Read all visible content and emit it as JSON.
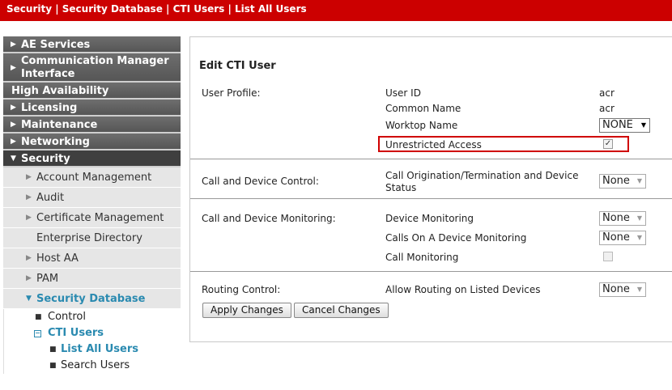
{
  "breadcrumb": "Security | Security Database | CTI Users | List All Users",
  "sidebar": {
    "main_top": [
      {
        "label": "AE Services",
        "arrow": "▶"
      },
      {
        "label": "Communication Manager Interface",
        "arrow": "▶"
      },
      {
        "label": "High Availability",
        "arrow": ""
      },
      {
        "label": "Licensing",
        "arrow": "▶"
      },
      {
        "label": "Maintenance",
        "arrow": "▶"
      },
      {
        "label": "Networking",
        "arrow": "▶"
      },
      {
        "label": "Security",
        "arrow": "▼"
      }
    ],
    "security_items": [
      {
        "label": "Account Management",
        "arrow": "▶"
      },
      {
        "label": "Audit",
        "arrow": "▶"
      },
      {
        "label": "Certificate Management",
        "arrow": "▶"
      },
      {
        "label": "Enterprise Directory",
        "arrow": ""
      },
      {
        "label": "Host AA",
        "arrow": "▶"
      },
      {
        "label": "PAM",
        "arrow": "▶"
      },
      {
        "label": "Security Database",
        "arrow": "▼"
      }
    ],
    "db_items": {
      "control": "Control",
      "cti_users": "CTI Users",
      "list_all": "List All Users",
      "search": "Search Users"
    }
  },
  "form": {
    "title": "Edit CTI User",
    "user_profile_label": "User Profile:",
    "user_id_label": "User ID",
    "user_id_value": "acr",
    "common_name_label": "Common Name",
    "common_name_value": "acr",
    "worktop_label": "Worktop Name",
    "worktop_value": "NONE",
    "unrestricted_label": "Unrestricted Access",
    "unrestricted_checked": true,
    "call_device_control_label": "Call and Device Control:",
    "call_origination_label": "Call Origination/Termination and Device Status",
    "call_origination_value": "None",
    "call_device_monitoring_label": "Call and Device Monitoring:",
    "device_monitoring_label": "Device Monitoring",
    "device_monitoring_value": "None",
    "calls_on_device_label": "Calls On A Device Monitoring",
    "calls_on_device_value": "None",
    "call_monitoring_label": "Call Monitoring",
    "call_monitoring_checked": false,
    "routing_control_label": "Routing Control:",
    "allow_routing_label": "Allow Routing on Listed Devices",
    "allow_routing_value": "None",
    "apply_label": "Apply Changes",
    "cancel_label": "Cancel Changes"
  },
  "icons": {
    "chevron": "chevron-down-icon",
    "arrow_right": "triangle-right-icon",
    "arrow_down": "triangle-down-icon"
  },
  "colors": {
    "header": "#cc0000",
    "link": "#2a8ab0",
    "highlight": "#d00000"
  }
}
